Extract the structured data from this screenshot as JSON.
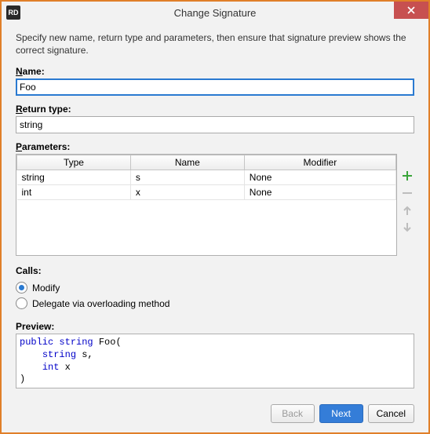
{
  "window": {
    "app_icon_text": "RD",
    "title": "Change Signature"
  },
  "instruction": "Specify new name, return type and parameters, then ensure that signature preview shows the correct signature.",
  "labels": {
    "name": "Name:",
    "return_type": "Return type:",
    "parameters": "Parameters:",
    "calls": "Calls:",
    "preview": "Preview:"
  },
  "fields": {
    "name_value": "Foo",
    "return_type_value": "string"
  },
  "parameters": {
    "columns": [
      "Type",
      "Name",
      "Modifier"
    ],
    "rows": [
      {
        "type": "string",
        "name": "s",
        "modifier": "None"
      },
      {
        "type": "int",
        "name": "x",
        "modifier": "None"
      }
    ]
  },
  "calls": {
    "modify": "Modify",
    "delegate": "Delegate via overloading method",
    "selected": "modify"
  },
  "preview_code": {
    "kw1": "public",
    "kw2": "string",
    "fn": "Foo",
    "line2_kw": "string",
    "line2_rest": " s,",
    "line3_kw": "int",
    "line3_rest": " x"
  },
  "buttons": {
    "back": "Back",
    "next": "Next",
    "cancel": "Cancel"
  }
}
